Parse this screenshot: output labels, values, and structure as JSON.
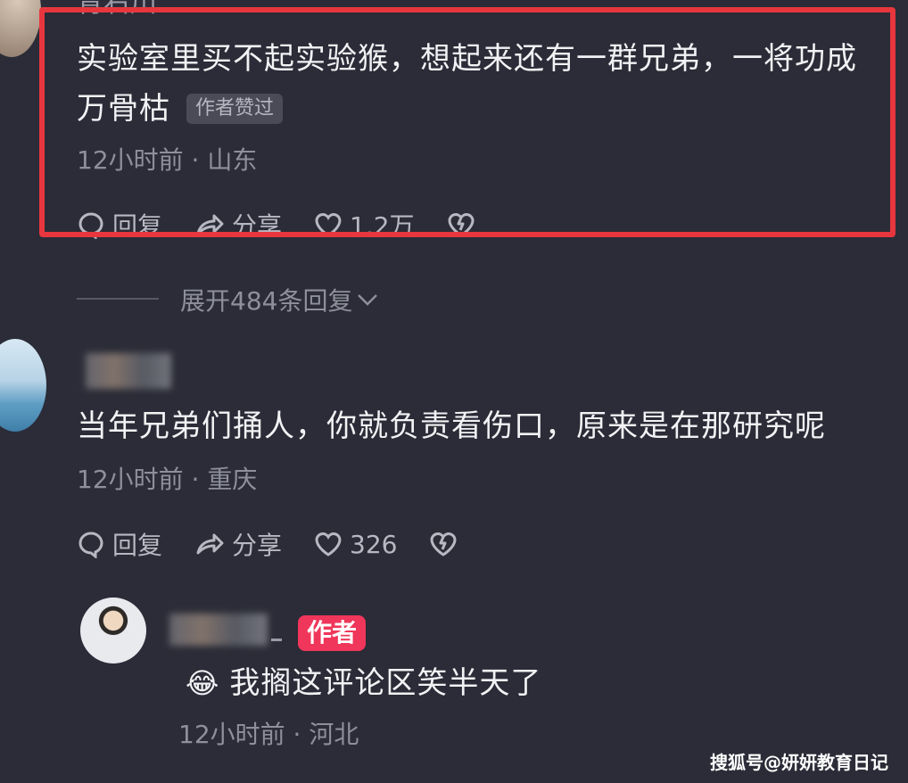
{
  "comment1": {
    "username_partial": "青右川",
    "text_line1": "实验室里买不起实验猴，想起来还有一群兄弟，一将功成",
    "text_line2": "万骨枯",
    "liked_badge": "作者赞过",
    "time_location": "12小时前 · 山东",
    "actions": {
      "reply": "回复",
      "share": "分享",
      "likes": "1.2万"
    }
  },
  "expand_replies": "展开484条回复",
  "comment2": {
    "text": "当年兄弟们捅人，你就负责看伤口，原来是在那研究呢",
    "time_location": "12小时前 · 重庆",
    "actions": {
      "reply": "回复",
      "share": "分享",
      "likes": "326"
    }
  },
  "reply": {
    "author_badge": "作者",
    "emoji": "😂",
    "text": "我搁这评论区笑半天了",
    "time_location": "12小时前 · 河北"
  },
  "watermark": "搜狐号@妍妍教育日记",
  "colors": {
    "background": "#2b2c37",
    "highlight": "#e8363e",
    "author_badge": "#f0365a"
  }
}
